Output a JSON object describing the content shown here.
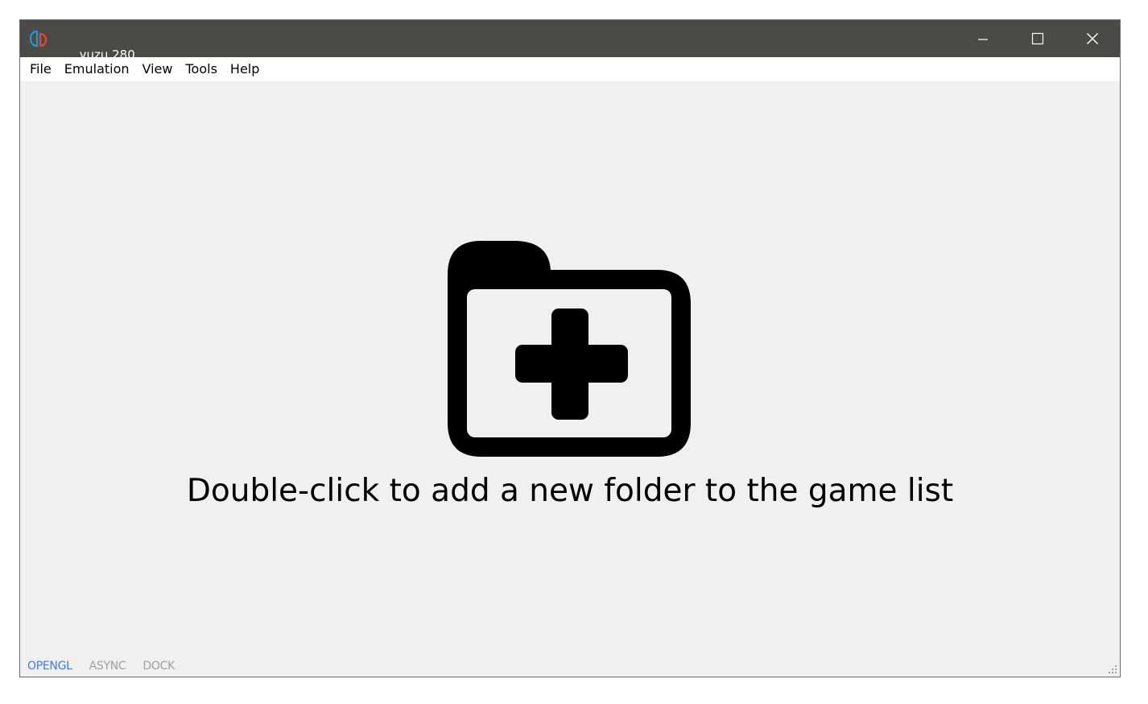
{
  "window": {
    "title": "yuzu 280",
    "title_suffix": ".",
    "app_icon": "yuzu-logo-icon",
    "controls": {
      "minimize_icon": "minimize-icon",
      "maximize_icon": "maximize-icon",
      "close_icon": "close-icon"
    }
  },
  "menubar": {
    "items": [
      {
        "label": "File"
      },
      {
        "label": "Emulation"
      },
      {
        "label": "View"
      },
      {
        "label": "Tools"
      },
      {
        "label": "Help"
      }
    ]
  },
  "main": {
    "icon": "folder-add-icon",
    "prompt": "Double-click to add a new folder to the game list"
  },
  "statusbar": {
    "items": [
      {
        "label": "OPENGL",
        "active": true
      },
      {
        "label": "ASYNC",
        "active": false
      },
      {
        "label": "DOCK",
        "active": false
      }
    ]
  },
  "colors": {
    "titlebar": "#4a4a47",
    "background": "#f0f0f0",
    "status_active": "#3a78ff",
    "status_inactive": "#a0a0a0",
    "logo_left": "#1e9bd7",
    "logo_right": "#e6462d"
  }
}
